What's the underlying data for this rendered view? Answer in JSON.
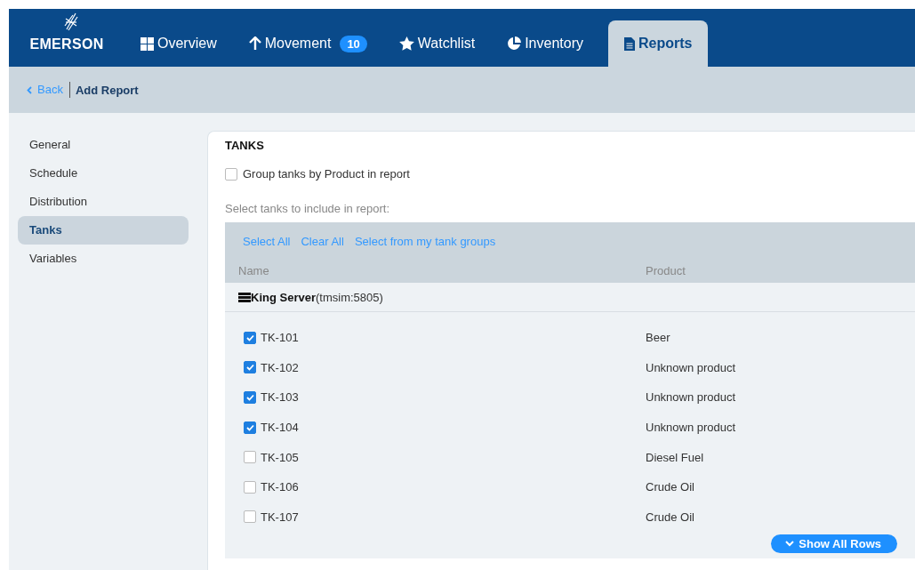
{
  "brand": {
    "name": "EMERSON"
  },
  "nav_tabs": [
    {
      "label": "Overview",
      "kind": "grid",
      "selected": false
    },
    {
      "label": "Movement",
      "kind": "arrow",
      "badge": "10",
      "selected": false
    },
    {
      "label": "Watchlist",
      "kind": "star",
      "selected": false
    },
    {
      "label": "Inventory",
      "kind": "pie",
      "selected": false
    },
    {
      "label": "Reports",
      "kind": "doc",
      "selected": true
    }
  ],
  "breadcrumb": {
    "back": "Back",
    "title": "Add Report"
  },
  "sidebar": {
    "items": [
      {
        "label": "General",
        "selected": false
      },
      {
        "label": "Schedule",
        "selected": false
      },
      {
        "label": "Distribution",
        "selected": false
      },
      {
        "label": "Tanks",
        "selected": true
      },
      {
        "label": "Variables",
        "selected": false
      }
    ]
  },
  "section": {
    "title": "TANKS",
    "group_option": {
      "label": "Group tanks by Product in report",
      "checked": false
    },
    "instruction": "Select tanks to include in report:"
  },
  "table": {
    "actions": [
      "Select All",
      "Clear All",
      "Select from my tank groups"
    ],
    "columns": [
      "Name",
      "Product"
    ],
    "server": {
      "name": "King Server",
      "address": "(tmsim:5805)"
    },
    "rows": [
      {
        "name": "TK-101",
        "product": "Beer",
        "checked": true
      },
      {
        "name": "TK-102",
        "product": "Unknown product",
        "checked": true
      },
      {
        "name": "TK-103",
        "product": "Unknown product",
        "checked": true
      },
      {
        "name": "TK-104",
        "product": "Unknown product",
        "checked": true
      },
      {
        "name": "TK-105",
        "product": "Diesel Fuel",
        "checked": false
      },
      {
        "name": "TK-106",
        "product": "Crude Oil",
        "checked": false
      },
      {
        "name": "TK-107",
        "product": "Crude Oil",
        "checked": false
      }
    ],
    "show_all": "Show All Rows"
  }
}
